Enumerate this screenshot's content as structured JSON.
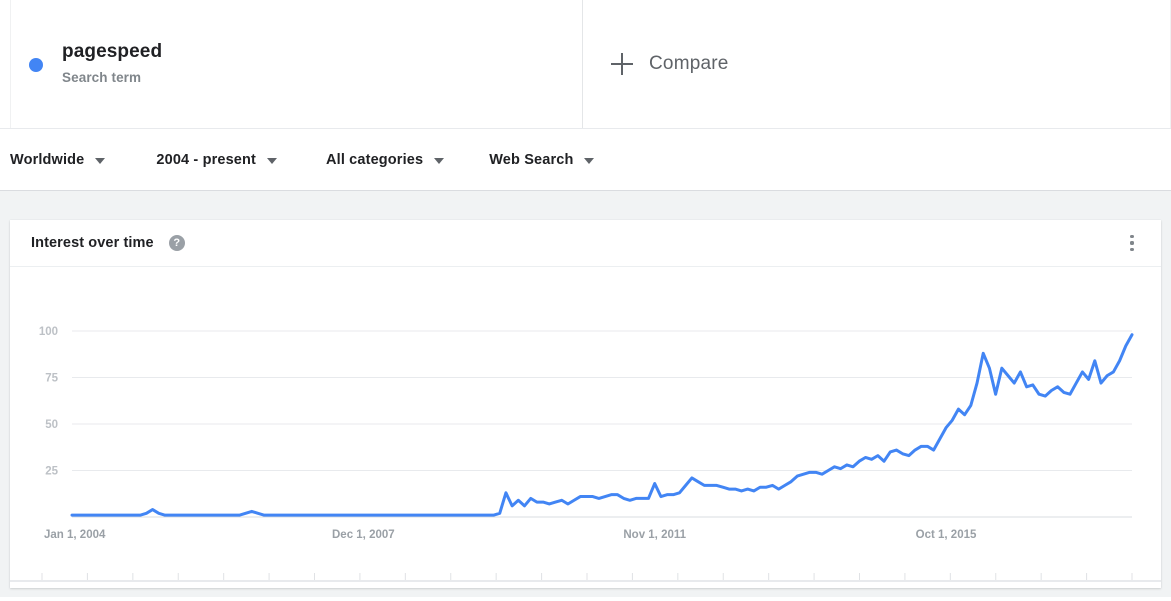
{
  "terms": [
    {
      "name": "pagespeed",
      "type_label": "Search term",
      "color": "#4285f4",
      "dot_icon": "series-dot-icon"
    }
  ],
  "compare": {
    "label": "Compare",
    "icon": "plus-icon"
  },
  "filters": [
    {
      "label": "Worldwide",
      "icon": "chevron-down-icon"
    },
    {
      "label": "2004 - present",
      "icon": "chevron-down-icon"
    },
    {
      "label": "All categories",
      "icon": "chevron-down-icon"
    },
    {
      "label": "Web Search",
      "icon": "chevron-down-icon"
    }
  ],
  "card": {
    "title": "Interest over time",
    "help_icon": "help-icon",
    "help_glyph": "?",
    "menu_icon": "more-options-icon"
  },
  "chart_data": {
    "type": "line",
    "title": "Interest over time",
    "xlabel": "",
    "ylabel": "",
    "ylim": [
      0,
      100
    ],
    "yticks": [
      25,
      50,
      75,
      100
    ],
    "grid": true,
    "legend": "none",
    "line_color": "#4285f4",
    "xtick_labels": [
      "Jan 1, 2004",
      "Dec 1, 2007",
      "Nov 1, 2011",
      "Oct 1, 2015"
    ],
    "xtick_positions": [
      0,
      47,
      94,
      141
    ],
    "x_start": "Jan 1, 2004",
    "x_end": "present",
    "series": [
      {
        "name": "pagespeed",
        "values": [
          1,
          1,
          1,
          1,
          1,
          1,
          1,
          1,
          1,
          1,
          1,
          1,
          2,
          4,
          2,
          1,
          1,
          1,
          1,
          1,
          1,
          1,
          1,
          1,
          1,
          1,
          1,
          1,
          2,
          3,
          2,
          1,
          1,
          1,
          1,
          1,
          1,
          1,
          1,
          1,
          1,
          1,
          1,
          1,
          1,
          1,
          1,
          1,
          1,
          1,
          1,
          1,
          1,
          1,
          1,
          1,
          1,
          1,
          1,
          1,
          1,
          1,
          1,
          1,
          1,
          1,
          1,
          1,
          1,
          2,
          13,
          6,
          9,
          6,
          10,
          8,
          8,
          7,
          8,
          9,
          7,
          9,
          11,
          11,
          11,
          10,
          11,
          12,
          12,
          10,
          9,
          10,
          10,
          10,
          18,
          11,
          12,
          12,
          13,
          17,
          21,
          19,
          17,
          17,
          17,
          16,
          15,
          15,
          14,
          15,
          14,
          16,
          16,
          17,
          15,
          17,
          19,
          22,
          23,
          24,
          24,
          23,
          25,
          27,
          26,
          28,
          27,
          30,
          32,
          31,
          33,
          30,
          35,
          36,
          34,
          33,
          36,
          38,
          38,
          36,
          42,
          48,
          52,
          58,
          55,
          60,
          72,
          88,
          80,
          66,
          80,
          76,
          72,
          78,
          70,
          71,
          66,
          65,
          68,
          70,
          67,
          66,
          72,
          78,
          74,
          84,
          72,
          76,
          78,
          84,
          92,
          98
        ]
      }
    ]
  }
}
